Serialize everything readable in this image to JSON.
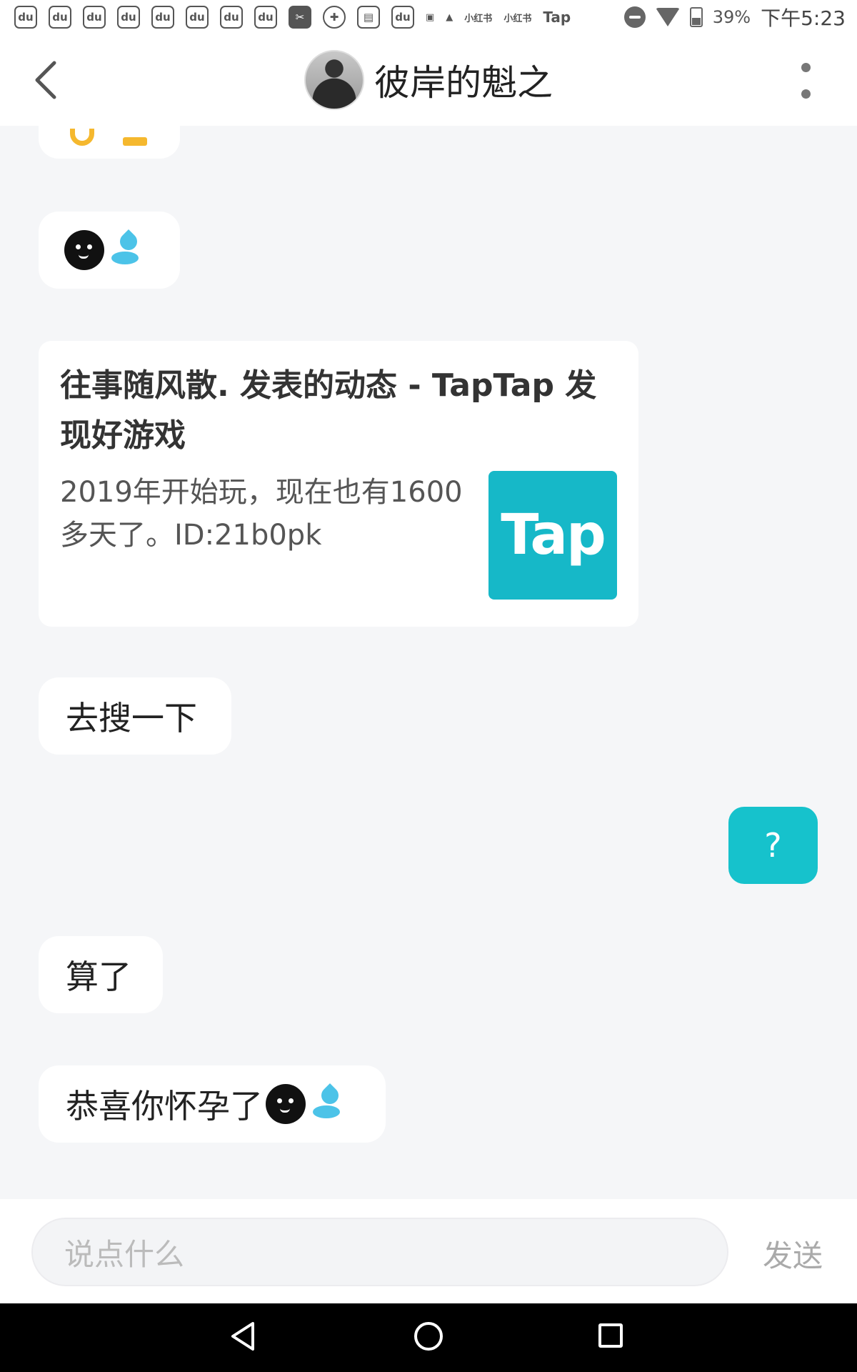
{
  "status_bar": {
    "battery": "39%",
    "time": "下午5:23",
    "app_icons": [
      "du",
      "du",
      "du",
      "du",
      "du",
      "du",
      "du",
      "du",
      "✂",
      "✚",
      "▤",
      "du",
      "▣",
      "▲",
      "小红书",
      "小红书",
      "Tap"
    ]
  },
  "header": {
    "title": "彼岸的魁之"
  },
  "messages": {
    "emoji_bubble": "",
    "card": {
      "title": "往事随风散. 发表的动态 - TapTap 发现好游戏",
      "description": "2019年开始玩，现在也有1600多天了。ID:21b0pk",
      "logo_text": "Tap"
    },
    "m1": "去搜一下",
    "sent": "?",
    "m2": "算了",
    "m3": "恭喜你怀孕了"
  },
  "input": {
    "placeholder": "说点什么",
    "send_label": "发送"
  },
  "colors": {
    "accent": "#16c2cc",
    "tap_brand": "#16b8c8",
    "background": "#f5f6f8"
  }
}
